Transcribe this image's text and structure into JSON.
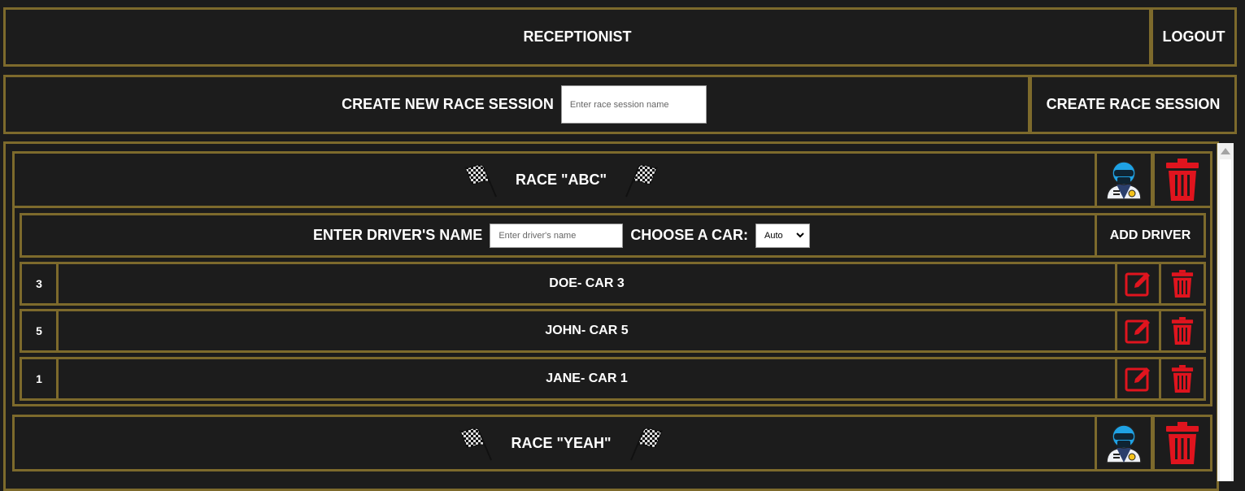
{
  "header": {
    "title": "RECEPTIONIST",
    "logout_label": "LOGOUT"
  },
  "create_session": {
    "label": "CREATE NEW RACE SESSION",
    "placeholder": "Enter race session name",
    "button_label": "CREATE RACE SESSION"
  },
  "races": [
    {
      "title": "RACE \"ABC\"",
      "add_driver": {
        "name_label": "ENTER DRIVER'S NAME",
        "name_placeholder": "Enter driver's name",
        "car_label": "CHOOSE A CAR:",
        "car_selected": "Auto",
        "button_label": "ADD DRIVER"
      },
      "drivers": [
        {
          "car": "3",
          "label": "DOE- CAR 3"
        },
        {
          "car": "5",
          "label": "JOHN- CAR 5"
        },
        {
          "car": "1",
          "label": "JANE- CAR 1"
        }
      ]
    },
    {
      "title": "RACE \"YEAH\""
    }
  ],
  "colors": {
    "accent_border": "#7d6a2c",
    "background": "#1c1c1c",
    "danger": "#e0141e"
  },
  "icons": [
    "checkered-flag-icon",
    "driver-icon",
    "trash-icon",
    "edit-icon",
    "chevron-down-icon"
  ]
}
